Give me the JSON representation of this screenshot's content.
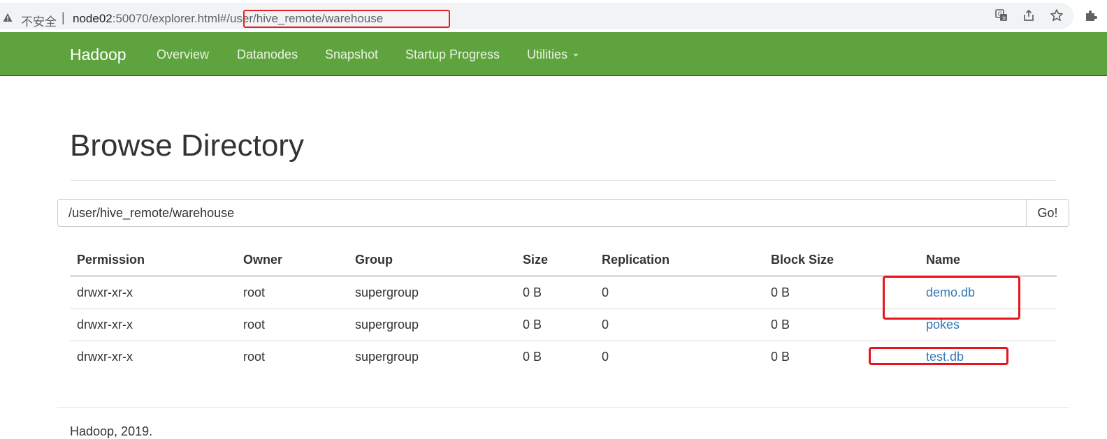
{
  "browser": {
    "security_label": "不安全",
    "separator": "|",
    "url_host": "node02",
    "url_rest": ":50070/explorer.html#",
    "url_hash": "/user/hive_remote/warehouse",
    "icons": [
      "warning-icon",
      "translate-icon",
      "share-icon",
      "star-icon",
      "extension-icon"
    ]
  },
  "navbar": {
    "brand": "Hadoop",
    "links": [
      "Overview",
      "Datanodes",
      "Snapshot",
      "Startup Progress",
      "Utilities"
    ],
    "color": "#5fa33e"
  },
  "page": {
    "title": "Browse Directory",
    "path_value": "/user/hive_remote/warehouse",
    "go_label": "Go!"
  },
  "table": {
    "headers": [
      "Permission",
      "Owner",
      "Group",
      "Size",
      "Replication",
      "Block Size",
      "Name"
    ],
    "rows": [
      [
        "drwxr-xr-x",
        "root",
        "supergroup",
        "0 B",
        "0",
        "0 B",
        "demo.db"
      ],
      [
        "drwxr-xr-x",
        "root",
        "supergroup",
        "0 B",
        "0",
        "0 B",
        "pokes"
      ],
      [
        "drwxr-xr-x",
        "root",
        "supergroup",
        "0 B",
        "0",
        "0 B",
        "test.db"
      ]
    ],
    "link_color": "#337ab7"
  },
  "annotations": {
    "highlight_color": "#e8141d"
  },
  "footer": {
    "text": "Hadoop, 2019."
  }
}
